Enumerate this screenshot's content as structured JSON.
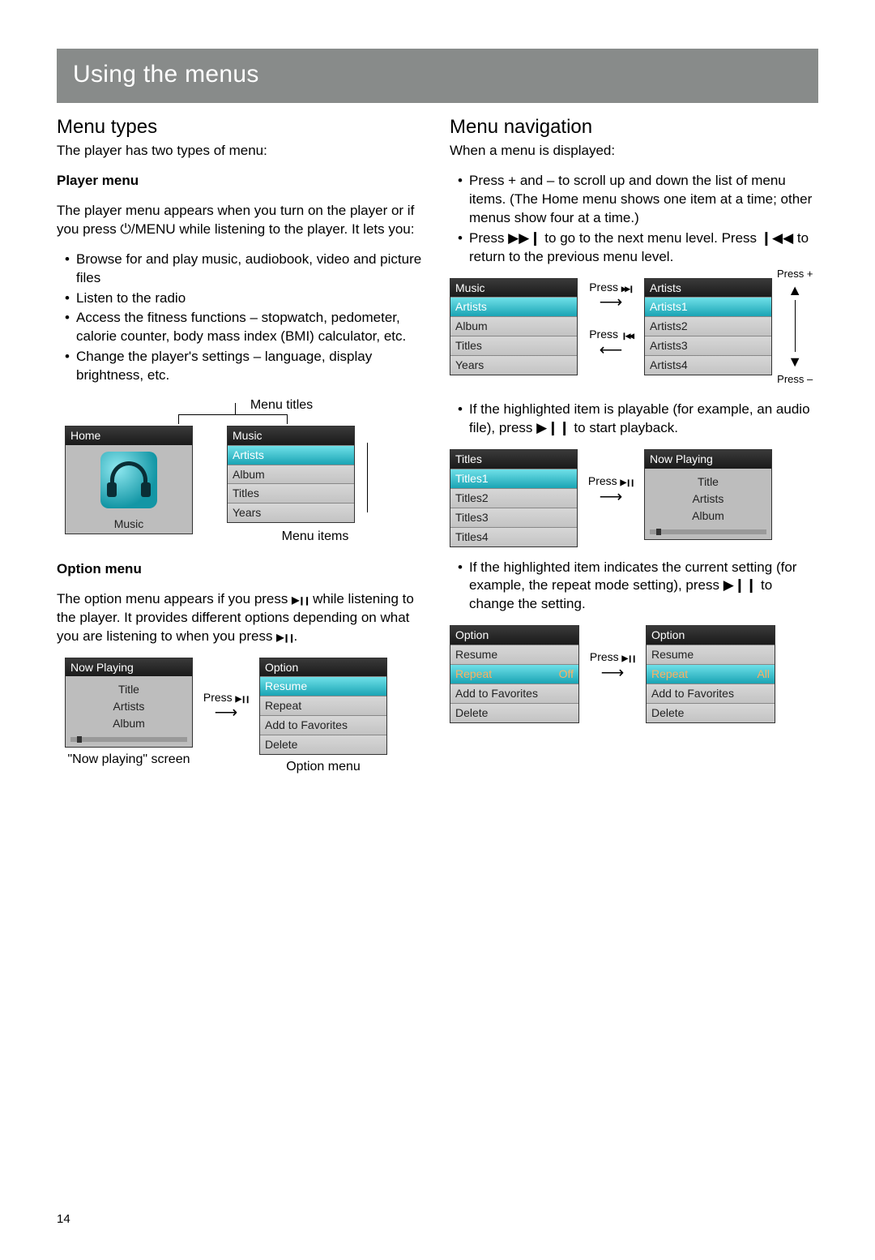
{
  "banner": "Using the menus",
  "pagenum": "14",
  "left": {
    "h_menu_types": "Menu types",
    "intro": "The player has two types of menu:",
    "player_menu_h": "Player menu",
    "player_menu_p": "The player menu appears when you turn on the player or if you press ⏻/MENU while listening to the player. It lets you:",
    "player_menu_items": [
      "Browse for and play music, audiobook, video and picture files",
      "Listen to the radio",
      "Access the fitness functions – stopwatch, pedometer, calorie counter, body mass index (BMI) calculator, etc.",
      "Change the player's settings – language, display brightness, etc."
    ],
    "annot_menu_titles": "Menu titles",
    "annot_menu_items": "Menu items",
    "home_title": "Home",
    "home_caption": "Music",
    "music_title": "Music",
    "music_rows": [
      "Artists",
      "Album",
      "Titles",
      "Years"
    ],
    "option_menu_h": "Option menu",
    "option_menu_p1": "The option menu appears if you press ",
    "option_menu_p2": " while listening to the player. It provides different options depending on what you are listening to when you press ",
    "now_playing_title": "Now Playing",
    "np_lines": [
      "Title",
      "Artists",
      "Album"
    ],
    "np_caption": "\"Now playing\" screen",
    "press_playpause": "Press ",
    "option_title": "Option",
    "option_rows": [
      "Resume",
      "Repeat",
      "Add to Favorites",
      "Delete"
    ],
    "option_caption": "Option menu"
  },
  "right": {
    "h_menu_nav": "Menu navigation",
    "intro": "When a menu is displayed:",
    "bullets1": [
      "Press + and – to scroll up and down the list of menu items. (The Home menu shows one item at a time; other menus show four at a time.)",
      "Press ▶▶❙ to go to the next menu level. Press ❙◀◀ to return to the previous menu level."
    ],
    "diag1": {
      "left_title": "Music",
      "left_rows": [
        "Artists",
        "Album",
        "Titles",
        "Years"
      ],
      "right_title": "Artists",
      "right_rows": [
        "Artists1",
        "Artists2",
        "Artists3",
        "Artists4"
      ],
      "press_plus": "Press +",
      "press_minus": "Press –",
      "press_fwd": "Press ",
      "press_back": "Press "
    },
    "bullets2": [
      "If the highlighted item is playable (for example, an audio file), press ▶❙❙ to start playback."
    ],
    "diag2": {
      "left_title": "Titles",
      "left_rows": [
        "Titles1",
        "Titles2",
        "Titles3",
        "Titles4"
      ],
      "right_title": "Now Playing",
      "np_lines": [
        "Title",
        "Artists",
        "Album"
      ],
      "press": "Press "
    },
    "bullets3": [
      "If the highlighted item indicates the current setting (for example, the repeat mode setting), press ▶❙❙ to change the setting."
    ],
    "diag3": {
      "title": "Option",
      "left_rows": [
        {
          "l": "Resume",
          "r": ""
        },
        {
          "l": "Repeat",
          "r": "Off",
          "hl": true
        },
        {
          "l": "Add to Favorites",
          "r": ""
        },
        {
          "l": "Delete",
          "r": ""
        }
      ],
      "right_rows": [
        {
          "l": "Resume",
          "r": ""
        },
        {
          "l": "Repeat",
          "r": "All",
          "hl": true
        },
        {
          "l": "Add to Favorites",
          "r": ""
        },
        {
          "l": "Delete",
          "r": ""
        }
      ],
      "press": "Press "
    }
  }
}
